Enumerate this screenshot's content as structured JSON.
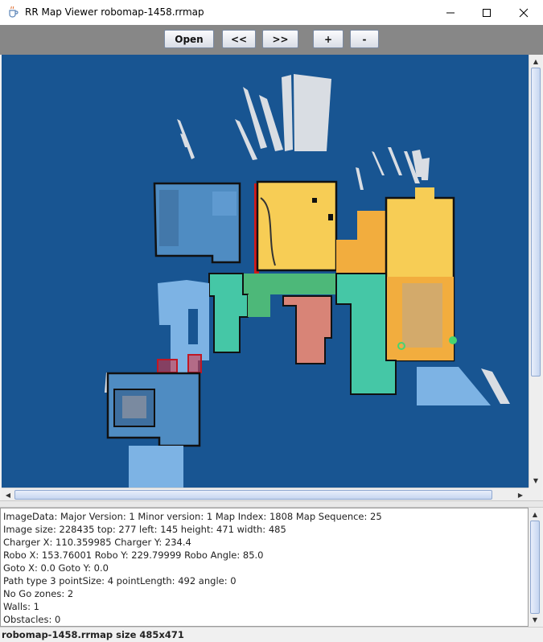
{
  "window": {
    "title": "RR Map Viewer robomap-1458.rrmap",
    "minimize_icon": "minimize-icon",
    "maximize_icon": "maximize-icon",
    "close_icon": "close-icon",
    "app_icon": "java-coffee-cup-icon"
  },
  "toolbar": {
    "open_label": "Open",
    "prev_label": "<<",
    "next_label": ">>",
    "zoom_in_label": "+",
    "zoom_out_label": "-"
  },
  "map": {
    "colors": {
      "background": "#185592",
      "room_blue": "#4f8cc2",
      "room_lightblue": "#7db3e4",
      "room_teal": "#45c7a6",
      "room_green": "#4db879",
      "room_yellow": "#f7cd55",
      "room_orange": "#f2ad3e",
      "room_salmon": "#d88477",
      "path_red": "#d11a1a",
      "no_go_zone": "#e0303a"
    }
  },
  "info": {
    "lines": [
      "ImageData: Major Version: 1 Minor version: 1 Map Index: 1808 Map Sequence: 25",
      "Image size: 228435 top: 277 left: 145 height: 471 width: 485",
      "Charger X: 110.359985 Charger Y: 234.4",
      "Robo X: 153.76001 Robo Y: 229.79999 Robo Angle: 85.0",
      "Goto X: 0.0 Goto Y: 0.0",
      "Path type 3 pointSize: 4 pointLength: 492 angle: 0",
      "No Go zones: 2",
      "Walls: 1",
      "Obstacles: 0"
    ]
  },
  "status": {
    "text": "robomap-1458.rrmap size 485x471"
  }
}
